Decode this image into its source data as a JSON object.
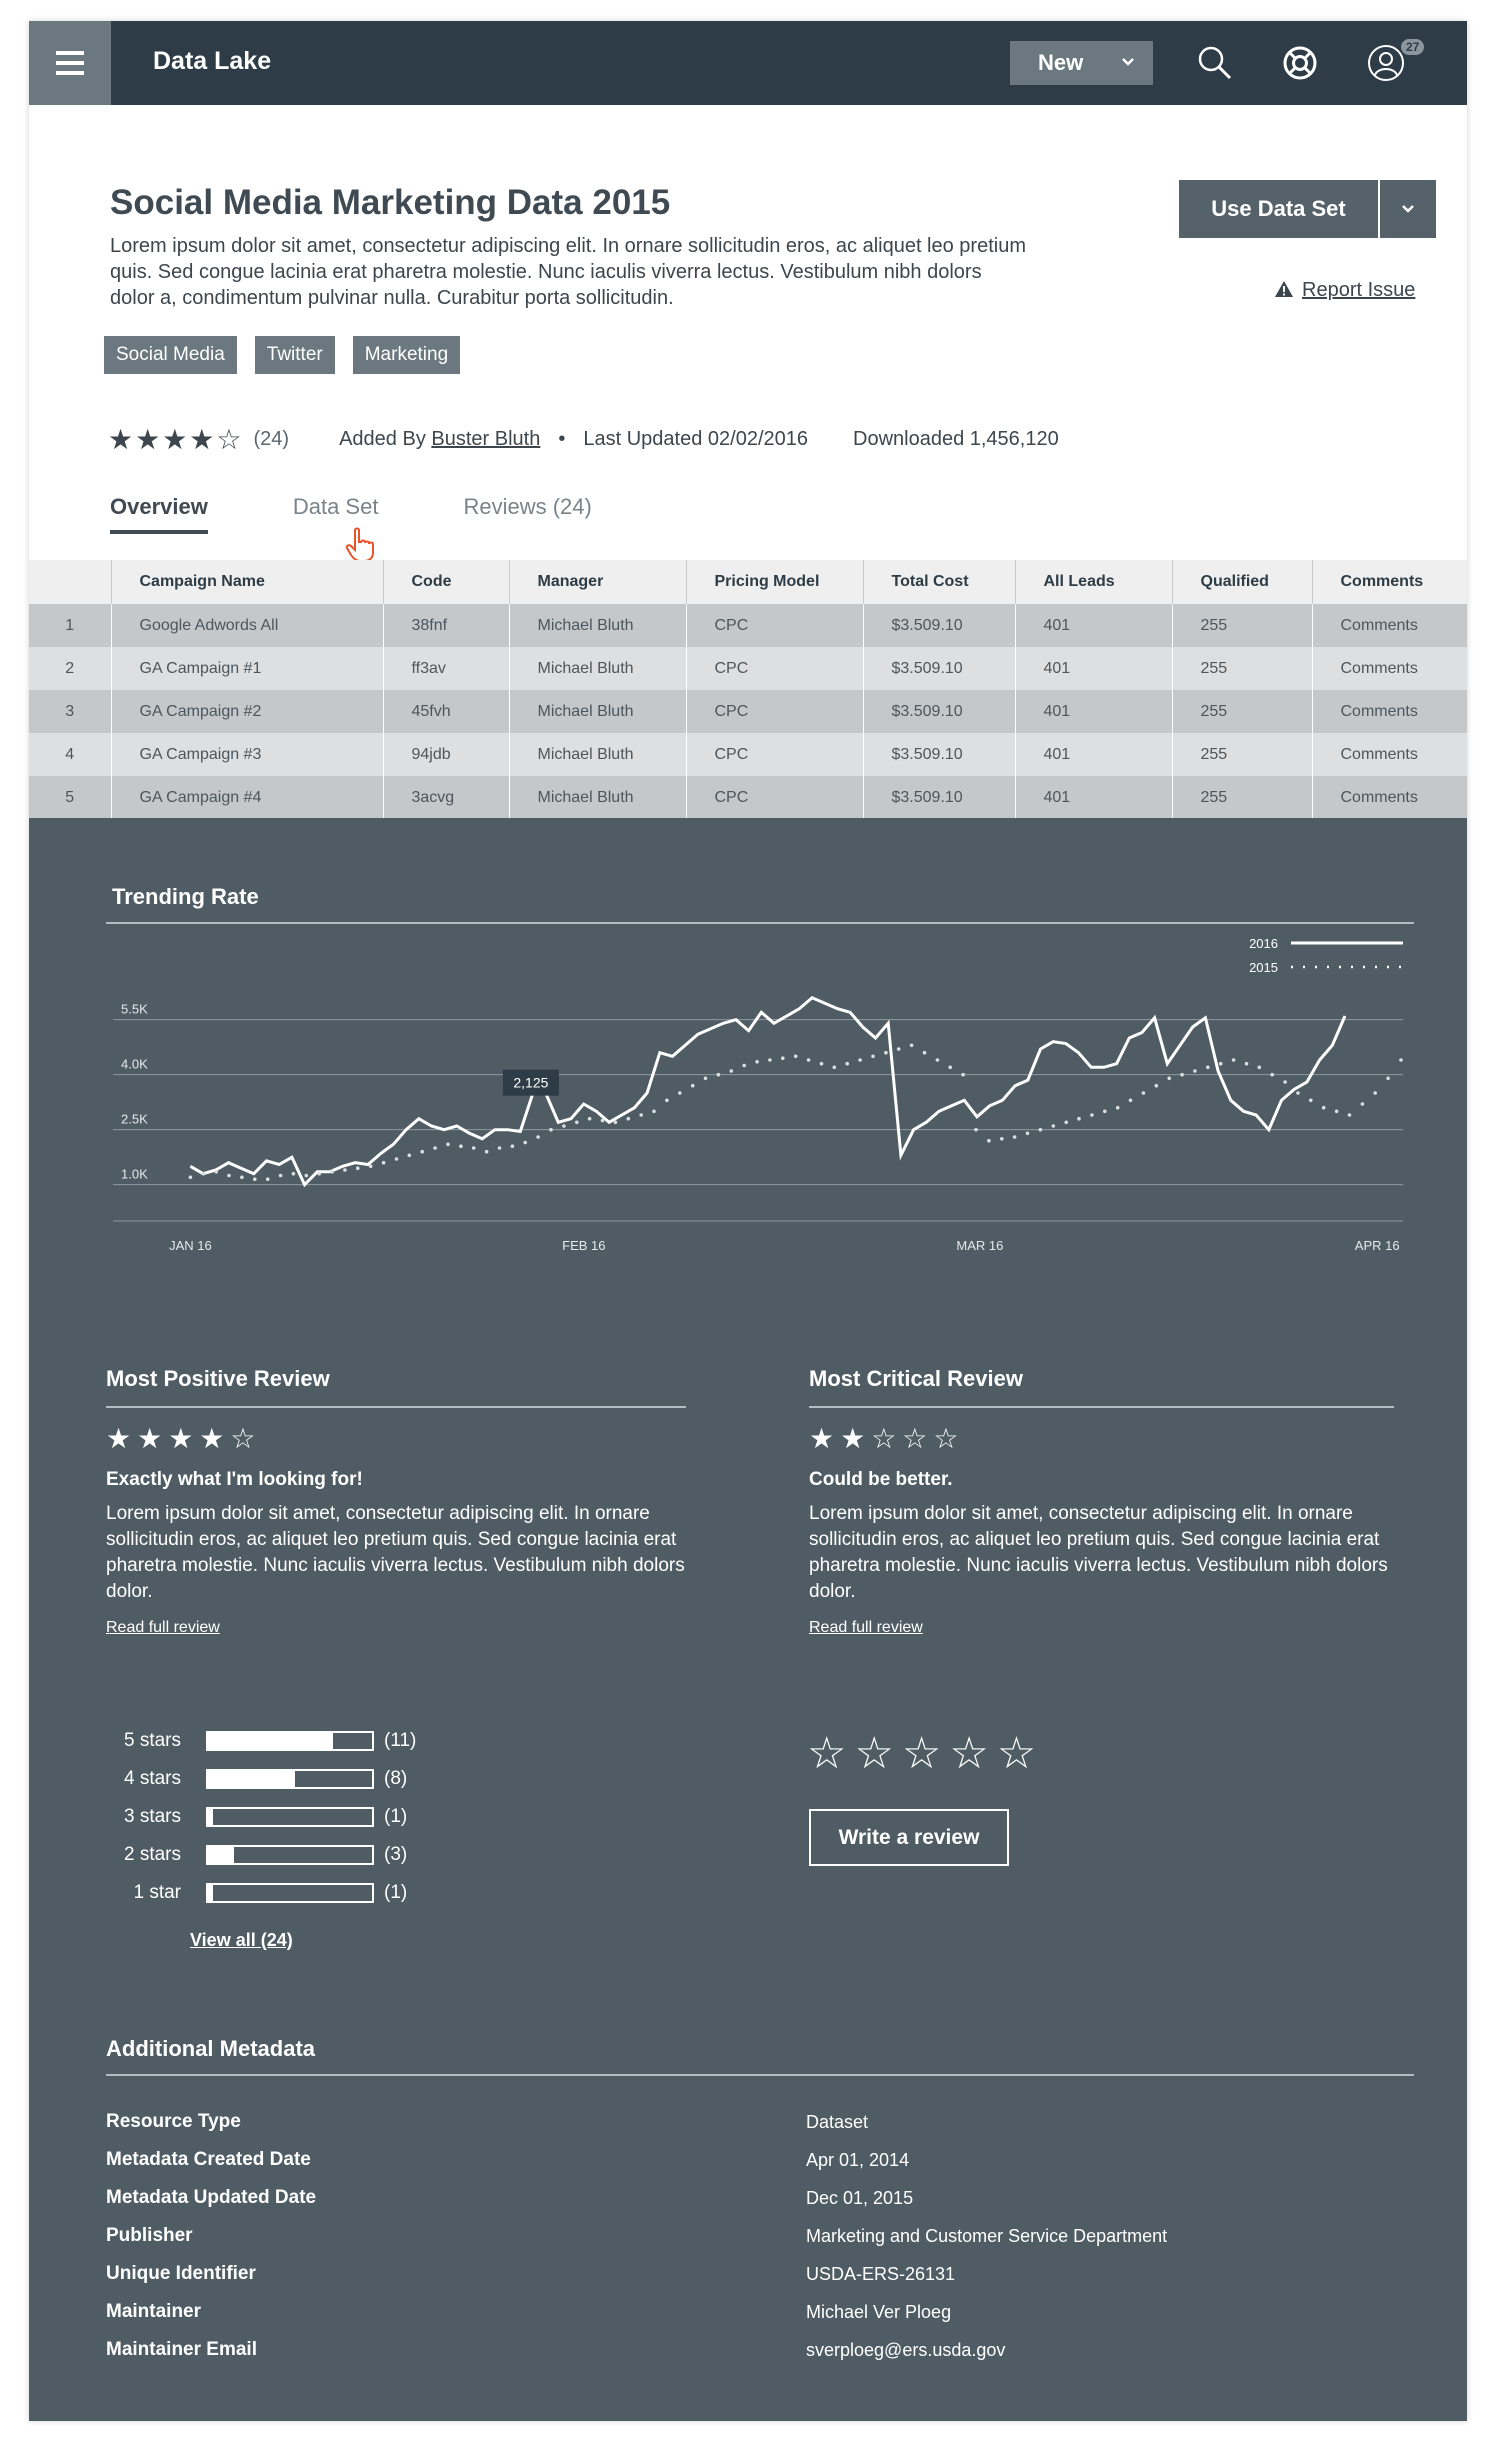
{
  "app": {
    "title": "Data Lake",
    "new_label": "New",
    "notification_count": "27"
  },
  "dataset": {
    "title": "Social Media Marketing Data 2015",
    "description": "Lorem ipsum dolor sit amet, consectetur adipiscing elit. In ornare sollicitudin eros, ac aliquet leo pretium quis. Sed congue lacinia erat pharetra molestie. Nunc iaculis viverra lectus. Vestibulum nibh dolors dolor a, condimentum pulvinar nulla. Curabitur porta sollicitudin.",
    "use_label": "Use Data Set",
    "report_label": "Report Issue",
    "tags": [
      "Social Media",
      "Twitter",
      "Marketing"
    ],
    "rating_count": "(24)",
    "added_by_prefix": "Added By",
    "added_by": "Buster Bluth",
    "last_updated": "Last Updated 02/02/2016",
    "downloaded": "Downloaded 1,456,120"
  },
  "tabs": [
    {
      "label": "Overview"
    },
    {
      "label": "Data Set"
    },
    {
      "label": "Reviews",
      "count": "(24)"
    }
  ],
  "table": {
    "headers": [
      "",
      "Campaign Name",
      "Code",
      "Manager",
      "Pricing Model",
      "Total Cost",
      "All Leads",
      "Qualified",
      "Comments"
    ],
    "rows": [
      [
        "1",
        "Google Adwords All",
        "38fnf",
        "Michael Bluth",
        "CPC",
        "$3.509.10",
        "401",
        "255",
        "Comments"
      ],
      [
        "2",
        "GA Campaign #1",
        "ff3av",
        "Michael Bluth",
        "CPC",
        "$3.509.10",
        "401",
        "255",
        "Comments"
      ],
      [
        "3",
        "GA Campaign #2",
        "45fvh",
        "Michael Bluth",
        "CPC",
        "$3.509.10",
        "401",
        "255",
        "Comments"
      ],
      [
        "4",
        "GA Campaign #3",
        "94jdb",
        "Michael Bluth",
        "CPC",
        "$3.509.10",
        "401",
        "255",
        "Comments"
      ],
      [
        "5",
        "GA Campaign #4",
        "3acvg",
        "Michael Bluth",
        "CPC",
        "$3.509.10",
        "401",
        "255",
        "Comments"
      ]
    ]
  },
  "chart_data": {
    "type": "line",
    "title": "Trending Rate",
    "legend_position": "top-right",
    "y_ticks": [
      "5.5K",
      "4.0K",
      "2.5K",
      "1.0K"
    ],
    "y_tick_values": [
      5500,
      4000,
      2500,
      1000
    ],
    "x_ticks": [
      "JAN 16",
      "FEB 16",
      "MAR 16",
      "APR 16"
    ],
    "ylim": [
      500,
      6500
    ],
    "tooltip": {
      "label": "2,125",
      "series": "2016",
      "index": 24
    },
    "series": [
      {
        "name": "2016",
        "style": "solid",
        "values": [
          1500,
          1300,
          1400,
          1600,
          1450,
          1300,
          1650,
          1550,
          1750,
          1000,
          1350,
          1350,
          1500,
          1600,
          1550,
          1850,
          2100,
          2500,
          2800,
          2600,
          2500,
          2600,
          2400,
          2250,
          2500,
          2500,
          2450,
          3500,
          3500,
          2700,
          2800,
          3200,
          3000,
          2700,
          2900,
          3100,
          3500,
          4600,
          4500,
          4800,
          5100,
          5250,
          5400,
          5500,
          5200,
          5700,
          5400,
          5600,
          5800,
          6100,
          5950,
          5800,
          5700,
          5300,
          5000,
          5400,
          1800,
          2500,
          2700,
          3000,
          3150,
          3300,
          2850,
          3150,
          3300,
          3700,
          3850,
          4700,
          4900,
          4850,
          4600,
          4200,
          4200,
          4300,
          5000,
          5150,
          5550,
          4300,
          4800,
          5300,
          5550,
          4100,
          3300,
          3000,
          2900,
          2500,
          3300,
          3600,
          3800,
          4400,
          4800,
          5600
        ]
      },
      {
        "name": "2015",
        "style": "dotted",
        "values": [
          1200,
          1300,
          1350,
          1250,
          1200,
          1150,
          1150,
          1250,
          1300,
          1250,
          1300,
          1350,
          1400,
          1450,
          1500,
          1600,
          1700,
          1800,
          1900,
          2000,
          2100,
          2050,
          2000,
          1900,
          2000,
          2050,
          2150,
          2300,
          2500,
          2600,
          2700,
          2800,
          2750,
          2700,
          2800,
          2900,
          3000,
          3300,
          3500,
          3700,
          3900,
          4000,
          4100,
          4250,
          4350,
          4400,
          4450,
          4500,
          4400,
          4300,
          4200,
          4300,
          4400,
          4500,
          4600,
          4700,
          4800,
          4600,
          4400,
          4200,
          4000,
          2500,
          2200,
          2250,
          2300,
          2400,
          2500,
          2600,
          2700,
          2800,
          2900,
          3000,
          3100,
          3300,
          3500,
          3700,
          3900,
          4000,
          4100,
          4200,
          4300,
          4400,
          4300,
          4200,
          4000,
          3800,
          3500,
          3300,
          3100,
          3000,
          2900,
          3200,
          3500,
          3900,
          4400
        ]
      }
    ]
  },
  "reviews": {
    "positive": {
      "section_title": "Most Positive Review",
      "stars": 4,
      "headline": "Exactly what I'm looking for!",
      "body": "Lorem ipsum dolor sit amet, consectetur adipiscing elit. In ornare sollicitudin eros, ac aliquet leo pretium quis. Sed congue lacinia erat pharetra molestie. Nunc iaculis viverra lectus. Vestibulum nibh dolors dolor.",
      "link": "Read full review"
    },
    "critical": {
      "section_title": "Most Critical Review",
      "stars": 2,
      "headline": "Could be better.",
      "body": "Lorem ipsum dolor sit amet, consectetur adipiscing elit. In ornare sollicitudin eros, ac aliquet leo pretium quis. Sed congue lacinia erat pharetra molestie. Nunc iaculis viverra lectus. Vestibulum nibh dolors dolor.",
      "link": "Read full review"
    },
    "distribution": [
      {
        "label": "5 stars",
        "count": "(11)",
        "fraction": 0.76
      },
      {
        "label": "4 stars",
        "count": "(8)",
        "fraction": 0.53
      },
      {
        "label": "3 stars",
        "count": "(1)",
        "fraction": 0.03
      },
      {
        "label": "2 stars",
        "count": "(3)",
        "fraction": 0.16
      },
      {
        "label": "1 star",
        "count": "(1)",
        "fraction": 0.03
      }
    ],
    "view_all": "View all (24)",
    "write_label": "Write a review"
  },
  "metadata": {
    "section_title": "Additional Metadata",
    "rows": [
      {
        "key": "Resource Type",
        "value": "Dataset"
      },
      {
        "key": "Metadata Created Date",
        "value": "Apr  01, 2014"
      },
      {
        "key": "Metadata Updated Date",
        "value": "Dec 01, 2015"
      },
      {
        "key": "Publisher",
        "value": "Marketing and Customer Service Department"
      },
      {
        "key": "Unique Identifier",
        "value": "USDA-ERS-26131"
      },
      {
        "key": "Maintainer",
        "value": "Michael Ver Ploeg"
      },
      {
        "key": "Maintainer Email",
        "value": "sverploeg@ers.usda.gov"
      }
    ]
  },
  "colors": {
    "header_bg": "#2d3c46",
    "dark_section_bg": "#4f5c64",
    "button_bg": "#56626a",
    "tag_bg": "#6b7880",
    "cursor_accent": "#e8542a"
  },
  "icons": [
    "menu-icon",
    "chevron-down-icon",
    "search-icon",
    "help-lifebuoy-icon",
    "user-avatar-icon",
    "warning-icon",
    "star-icon",
    "hand-cursor-icon"
  ]
}
